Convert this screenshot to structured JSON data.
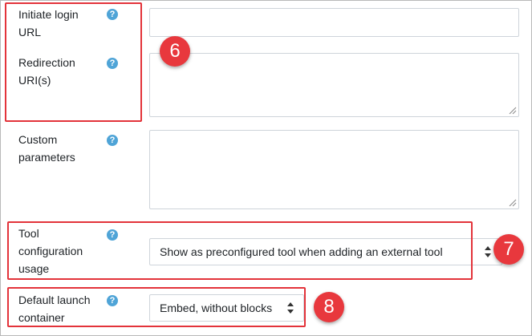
{
  "fields": {
    "initiate_login_url": {
      "label_line1": "Initiate login",
      "label_line2": "URL",
      "value": ""
    },
    "redirection_uris": {
      "label_line1": "Redirection",
      "label_line2": "URI(s)",
      "value": ""
    },
    "custom_parameters": {
      "label_line1": "Custom",
      "label_line2": "parameters",
      "value": ""
    },
    "tool_configuration_usage": {
      "label_line1": "Tool",
      "label_line2": "configuration",
      "label_line3": "usage",
      "selected": "Show as preconfigured tool when adding an external tool"
    },
    "default_launch_container": {
      "label_line1": "Default launch",
      "label_line2": "container",
      "selected": "Embed, without blocks"
    }
  },
  "help_icon_glyph": "?",
  "markers": {
    "m6": "6",
    "m7": "7",
    "m8": "8"
  },
  "colors": {
    "highlight": "#e3333a",
    "marker": "#e8383d",
    "help": "#4fa4d7"
  }
}
